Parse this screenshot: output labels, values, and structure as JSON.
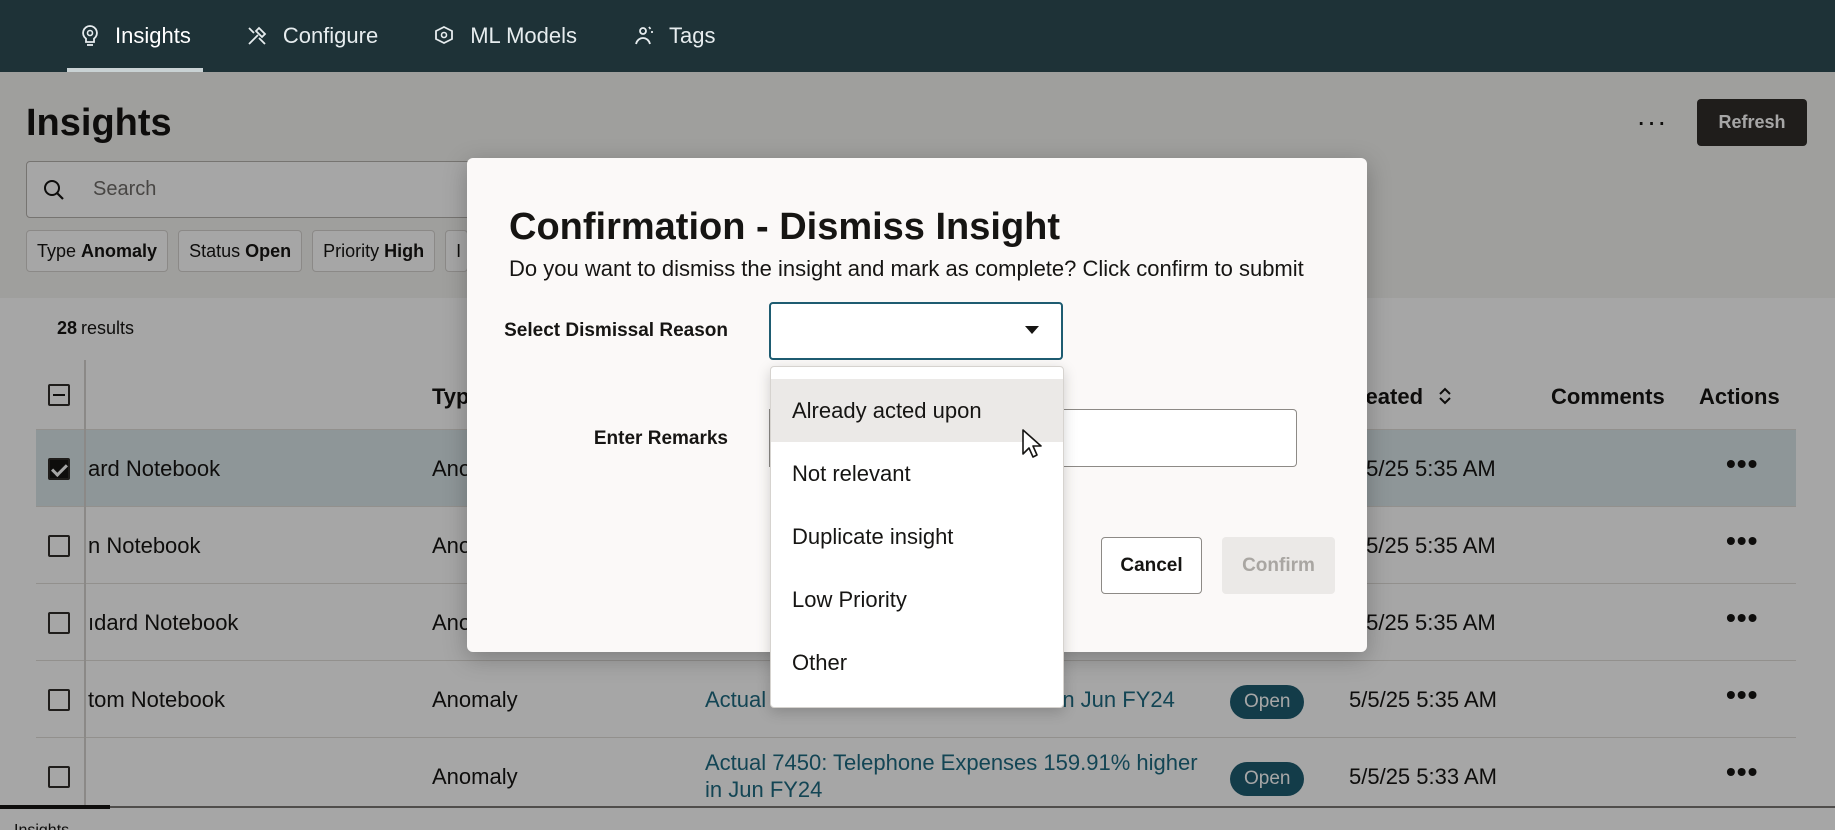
{
  "nav": {
    "tabs": [
      {
        "label": "Insights",
        "icon": "insights-icon"
      },
      {
        "label": "Configure",
        "icon": "tools-icon"
      },
      {
        "label": "ML Models",
        "icon": "ml-models-icon"
      },
      {
        "label": "Tags",
        "icon": "tags-icon"
      }
    ]
  },
  "header": {
    "title": "Insights",
    "more_label": "···",
    "refresh_label": "Refresh"
  },
  "search": {
    "placeholder": "Search"
  },
  "filters": [
    {
      "key": "Type",
      "value": "Anomaly"
    },
    {
      "key": "Status",
      "value": "Open"
    },
    {
      "key": "Priority",
      "value": "High"
    },
    {
      "key": "",
      "value": "I"
    }
  ],
  "results": {
    "count": "28",
    "label": "results"
  },
  "table": {
    "columns": {
      "type": "Typ",
      "created": "reated",
      "comments": "Comments",
      "actions": "Actions"
    },
    "rows": [
      {
        "name": "ard Notebook",
        "type": "Ano",
        "insight": "",
        "status": "",
        "created": "/5/25 5:35 AM",
        "checked": true
      },
      {
        "name": "n Notebook",
        "type": "Ano",
        "insight": "",
        "status": "",
        "created": "/5/25 5:35 AM",
        "checked": false
      },
      {
        "name": "ıdard Notebook",
        "type": "Ano",
        "insight": "",
        "status": "",
        "created": "/5/25 5:35 AM",
        "checked": false
      },
      {
        "name": "tom Notebook",
        "type": "Anomaly",
        "insight": "Actual",
        "insight2": "r in Jun FY24",
        "status": "Open",
        "created": "5/5/25 5:35 AM",
        "checked": false
      },
      {
        "name": "",
        "type": "Anomaly",
        "insight": "Actual 7450: Telephone Expenses 159.91% higher",
        "insight2": "in Jun FY24",
        "status": "Open",
        "created": "5/5/25 5:33 AM",
        "checked": false
      }
    ]
  },
  "bottom": {
    "text": "Insights"
  },
  "dialog": {
    "title": "Confirmation - Dismiss Insight",
    "description": "Do you want to dismiss the insight and mark as complete? Click confirm to submit",
    "reason_label": "Select Dismissal Reason",
    "remarks_label": "Enter Remarks",
    "cancel_label": "Cancel",
    "confirm_label": "Confirm",
    "options": [
      "Already acted upon",
      "Not relevant",
      "Duplicate insight",
      "Low Priority",
      "Other"
    ],
    "hovered_option": 0
  },
  "colors": {
    "nav_bg": "#1e3237",
    "accent": "#1e5c71",
    "link": "#1e6a82",
    "selected_row": "#dbe7ea"
  }
}
